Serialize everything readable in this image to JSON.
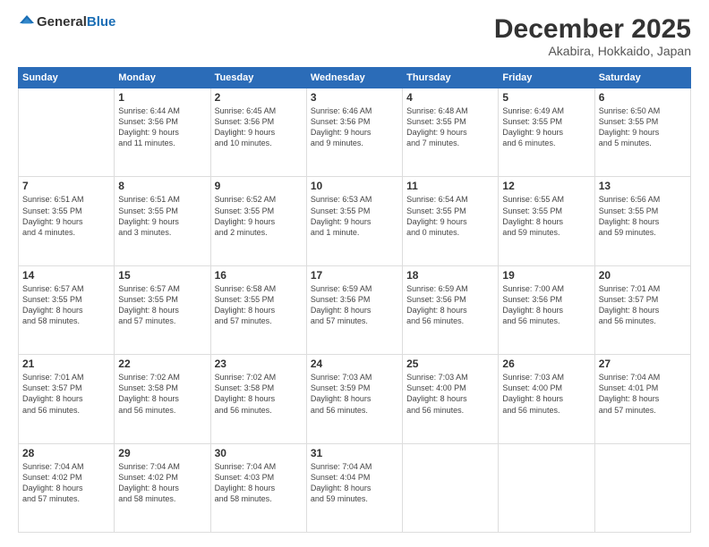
{
  "logo": {
    "general": "General",
    "blue": "Blue"
  },
  "header": {
    "month": "December 2025",
    "location": "Akabira, Hokkaido, Japan"
  },
  "weekdays": [
    "Sunday",
    "Monday",
    "Tuesday",
    "Wednesday",
    "Thursday",
    "Friday",
    "Saturday"
  ],
  "weeks": [
    [
      {
        "day": "",
        "info": ""
      },
      {
        "day": "1",
        "info": "Sunrise: 6:44 AM\nSunset: 3:56 PM\nDaylight: 9 hours\nand 11 minutes."
      },
      {
        "day": "2",
        "info": "Sunrise: 6:45 AM\nSunset: 3:56 PM\nDaylight: 9 hours\nand 10 minutes."
      },
      {
        "day": "3",
        "info": "Sunrise: 6:46 AM\nSunset: 3:56 PM\nDaylight: 9 hours\nand 9 minutes."
      },
      {
        "day": "4",
        "info": "Sunrise: 6:48 AM\nSunset: 3:55 PM\nDaylight: 9 hours\nand 7 minutes."
      },
      {
        "day": "5",
        "info": "Sunrise: 6:49 AM\nSunset: 3:55 PM\nDaylight: 9 hours\nand 6 minutes."
      },
      {
        "day": "6",
        "info": "Sunrise: 6:50 AM\nSunset: 3:55 PM\nDaylight: 9 hours\nand 5 minutes."
      }
    ],
    [
      {
        "day": "7",
        "info": "Sunrise: 6:51 AM\nSunset: 3:55 PM\nDaylight: 9 hours\nand 4 minutes."
      },
      {
        "day": "8",
        "info": "Sunrise: 6:51 AM\nSunset: 3:55 PM\nDaylight: 9 hours\nand 3 minutes."
      },
      {
        "day": "9",
        "info": "Sunrise: 6:52 AM\nSunset: 3:55 PM\nDaylight: 9 hours\nand 2 minutes."
      },
      {
        "day": "10",
        "info": "Sunrise: 6:53 AM\nSunset: 3:55 PM\nDaylight: 9 hours\nand 1 minute."
      },
      {
        "day": "11",
        "info": "Sunrise: 6:54 AM\nSunset: 3:55 PM\nDaylight: 9 hours\nand 0 minutes."
      },
      {
        "day": "12",
        "info": "Sunrise: 6:55 AM\nSunset: 3:55 PM\nDaylight: 8 hours\nand 59 minutes."
      },
      {
        "day": "13",
        "info": "Sunrise: 6:56 AM\nSunset: 3:55 PM\nDaylight: 8 hours\nand 59 minutes."
      }
    ],
    [
      {
        "day": "14",
        "info": "Sunrise: 6:57 AM\nSunset: 3:55 PM\nDaylight: 8 hours\nand 58 minutes."
      },
      {
        "day": "15",
        "info": "Sunrise: 6:57 AM\nSunset: 3:55 PM\nDaylight: 8 hours\nand 57 minutes."
      },
      {
        "day": "16",
        "info": "Sunrise: 6:58 AM\nSunset: 3:55 PM\nDaylight: 8 hours\nand 57 minutes."
      },
      {
        "day": "17",
        "info": "Sunrise: 6:59 AM\nSunset: 3:56 PM\nDaylight: 8 hours\nand 57 minutes."
      },
      {
        "day": "18",
        "info": "Sunrise: 6:59 AM\nSunset: 3:56 PM\nDaylight: 8 hours\nand 56 minutes."
      },
      {
        "day": "19",
        "info": "Sunrise: 7:00 AM\nSunset: 3:56 PM\nDaylight: 8 hours\nand 56 minutes."
      },
      {
        "day": "20",
        "info": "Sunrise: 7:01 AM\nSunset: 3:57 PM\nDaylight: 8 hours\nand 56 minutes."
      }
    ],
    [
      {
        "day": "21",
        "info": "Sunrise: 7:01 AM\nSunset: 3:57 PM\nDaylight: 8 hours\nand 56 minutes."
      },
      {
        "day": "22",
        "info": "Sunrise: 7:02 AM\nSunset: 3:58 PM\nDaylight: 8 hours\nand 56 minutes."
      },
      {
        "day": "23",
        "info": "Sunrise: 7:02 AM\nSunset: 3:58 PM\nDaylight: 8 hours\nand 56 minutes."
      },
      {
        "day": "24",
        "info": "Sunrise: 7:03 AM\nSunset: 3:59 PM\nDaylight: 8 hours\nand 56 minutes."
      },
      {
        "day": "25",
        "info": "Sunrise: 7:03 AM\nSunset: 4:00 PM\nDaylight: 8 hours\nand 56 minutes."
      },
      {
        "day": "26",
        "info": "Sunrise: 7:03 AM\nSunset: 4:00 PM\nDaylight: 8 hours\nand 56 minutes."
      },
      {
        "day": "27",
        "info": "Sunrise: 7:04 AM\nSunset: 4:01 PM\nDaylight: 8 hours\nand 57 minutes."
      }
    ],
    [
      {
        "day": "28",
        "info": "Sunrise: 7:04 AM\nSunset: 4:02 PM\nDaylight: 8 hours\nand 57 minutes."
      },
      {
        "day": "29",
        "info": "Sunrise: 7:04 AM\nSunset: 4:02 PM\nDaylight: 8 hours\nand 58 minutes."
      },
      {
        "day": "30",
        "info": "Sunrise: 7:04 AM\nSunset: 4:03 PM\nDaylight: 8 hours\nand 58 minutes."
      },
      {
        "day": "31",
        "info": "Sunrise: 7:04 AM\nSunset: 4:04 PM\nDaylight: 8 hours\nand 59 minutes."
      },
      {
        "day": "",
        "info": ""
      },
      {
        "day": "",
        "info": ""
      },
      {
        "day": "",
        "info": ""
      }
    ]
  ]
}
